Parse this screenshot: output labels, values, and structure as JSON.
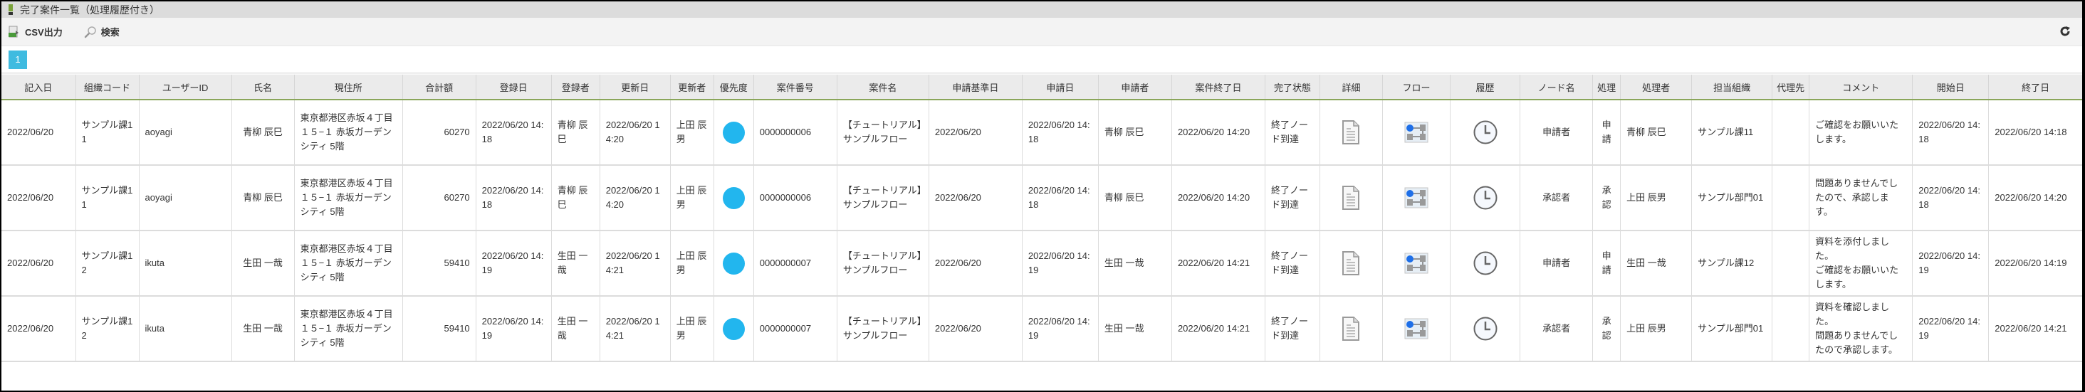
{
  "window": {
    "title": "完了案件一覧（処理履歴付き）"
  },
  "toolbar": {
    "csv_label": "CSV出力",
    "search_label": "検索",
    "refresh_icon": "refresh-icon"
  },
  "pager": {
    "current_page": "1"
  },
  "colors": {
    "accent": "#3fbbe0",
    "priority": "#22b6ee",
    "header_rule": "#8aa65a",
    "flow_node": "#1e6fe8"
  },
  "table": {
    "columns": [
      "記入日",
      "組織コード",
      "ユーザーID",
      "氏名",
      "現住所",
      "合計額",
      "登録日",
      "登録者",
      "更新日",
      "更新者",
      "優先度",
      "案件番号",
      "案件名",
      "申請基準日",
      "申請日",
      "申請者",
      "案件終了日",
      "完了状態",
      "詳細",
      "フロー",
      "履歴",
      "ノード名",
      "処理",
      "処理者",
      "担当組織",
      "代理先",
      "コメント",
      "開始日",
      "終了日"
    ],
    "rows": [
      {
        "entry_date": "2022/06/20",
        "org_code": "サンプル課11",
        "user_id": "aoyagi",
        "name": "青柳 辰巳",
        "address": "東京都港区赤坂４丁目１５−１ 赤坂ガーデンシティ 5階",
        "total": "60270",
        "reg_date": "2022/06/20 14:18",
        "registrant": "青柳 辰巳",
        "upd_date": "2022/06/20 14:20",
        "updater": "上田 辰男",
        "priority": "normal",
        "matter_no": "0000000006",
        "matter_name": "【チュートリアル】サンプルフロー",
        "apply_base_date": "2022/06/20",
        "apply_date": "2022/06/20 14:18",
        "applicant": "青柳 辰巳",
        "end_date": "2022/06/20 14:20",
        "status": "終了ノード到達",
        "node_name": "申請者",
        "action": "申請",
        "processor": "青柳 辰巳",
        "org": "サンプル課11",
        "proxy": "",
        "comment": "ご確認をお願いいたします。",
        "start": "2022/06/20 14:18",
        "finish": "2022/06/20 14:18"
      },
      {
        "entry_date": "2022/06/20",
        "org_code": "サンプル課11",
        "user_id": "aoyagi",
        "name": "青柳 辰巳",
        "address": "東京都港区赤坂４丁目１５−１ 赤坂ガーデンシティ 5階",
        "total": "60270",
        "reg_date": "2022/06/20 14:18",
        "registrant": "青柳 辰巳",
        "upd_date": "2022/06/20 14:20",
        "updater": "上田 辰男",
        "priority": "normal",
        "matter_no": "0000000006",
        "matter_name": "【チュートリアル】サンプルフロー",
        "apply_base_date": "2022/06/20",
        "apply_date": "2022/06/20 14:18",
        "applicant": "青柳 辰巳",
        "end_date": "2022/06/20 14:20",
        "status": "終了ノード到達",
        "node_name": "承認者",
        "action": "承認",
        "processor": "上田 辰男",
        "org": "サンプル部門01",
        "proxy": "",
        "comment": "問題ありませんでしたので、承認します。",
        "start": "2022/06/20 14:18",
        "finish": "2022/06/20 14:20"
      },
      {
        "entry_date": "2022/06/20",
        "org_code": "サンプル課12",
        "user_id": "ikuta",
        "name": "生田 一哉",
        "address": "東京都港区赤坂４丁目１５−１ 赤坂ガーデンシティ 5階",
        "total": "59410",
        "reg_date": "2022/06/20 14:19",
        "registrant": "生田 一哉",
        "upd_date": "2022/06/20 14:21",
        "updater": "上田 辰男",
        "priority": "normal",
        "matter_no": "0000000007",
        "matter_name": "【チュートリアル】サンプルフロー",
        "apply_base_date": "2022/06/20",
        "apply_date": "2022/06/20 14:19",
        "applicant": "生田 一哉",
        "end_date": "2022/06/20 14:21",
        "status": "終了ノード到達",
        "node_name": "申請者",
        "action": "申請",
        "processor": "生田 一哉",
        "org": "サンプル課12",
        "proxy": "",
        "comment": "資料を添付しました。\nご確認をお願いいたします。",
        "start": "2022/06/20 14:19",
        "finish": "2022/06/20 14:19"
      },
      {
        "entry_date": "2022/06/20",
        "org_code": "サンプル課12",
        "user_id": "ikuta",
        "name": "生田 一哉",
        "address": "東京都港区赤坂４丁目１５−１ 赤坂ガーデンシティ 5階",
        "total": "59410",
        "reg_date": "2022/06/20 14:19",
        "registrant": "生田 一哉",
        "upd_date": "2022/06/20 14:21",
        "updater": "上田 辰男",
        "priority": "normal",
        "matter_no": "0000000007",
        "matter_name": "【チュートリアル】サンプルフロー",
        "apply_base_date": "2022/06/20",
        "apply_date": "2022/06/20 14:19",
        "applicant": "生田 一哉",
        "end_date": "2022/06/20 14:21",
        "status": "終了ノード到達",
        "node_name": "承認者",
        "action": "承認",
        "processor": "上田 辰男",
        "org": "サンプル部門01",
        "proxy": "",
        "comment": "資料を確認しました。\n問題ありませんでしたので承認します。",
        "start": "2022/06/20 14:19",
        "finish": "2022/06/20 14:21"
      }
    ]
  }
}
